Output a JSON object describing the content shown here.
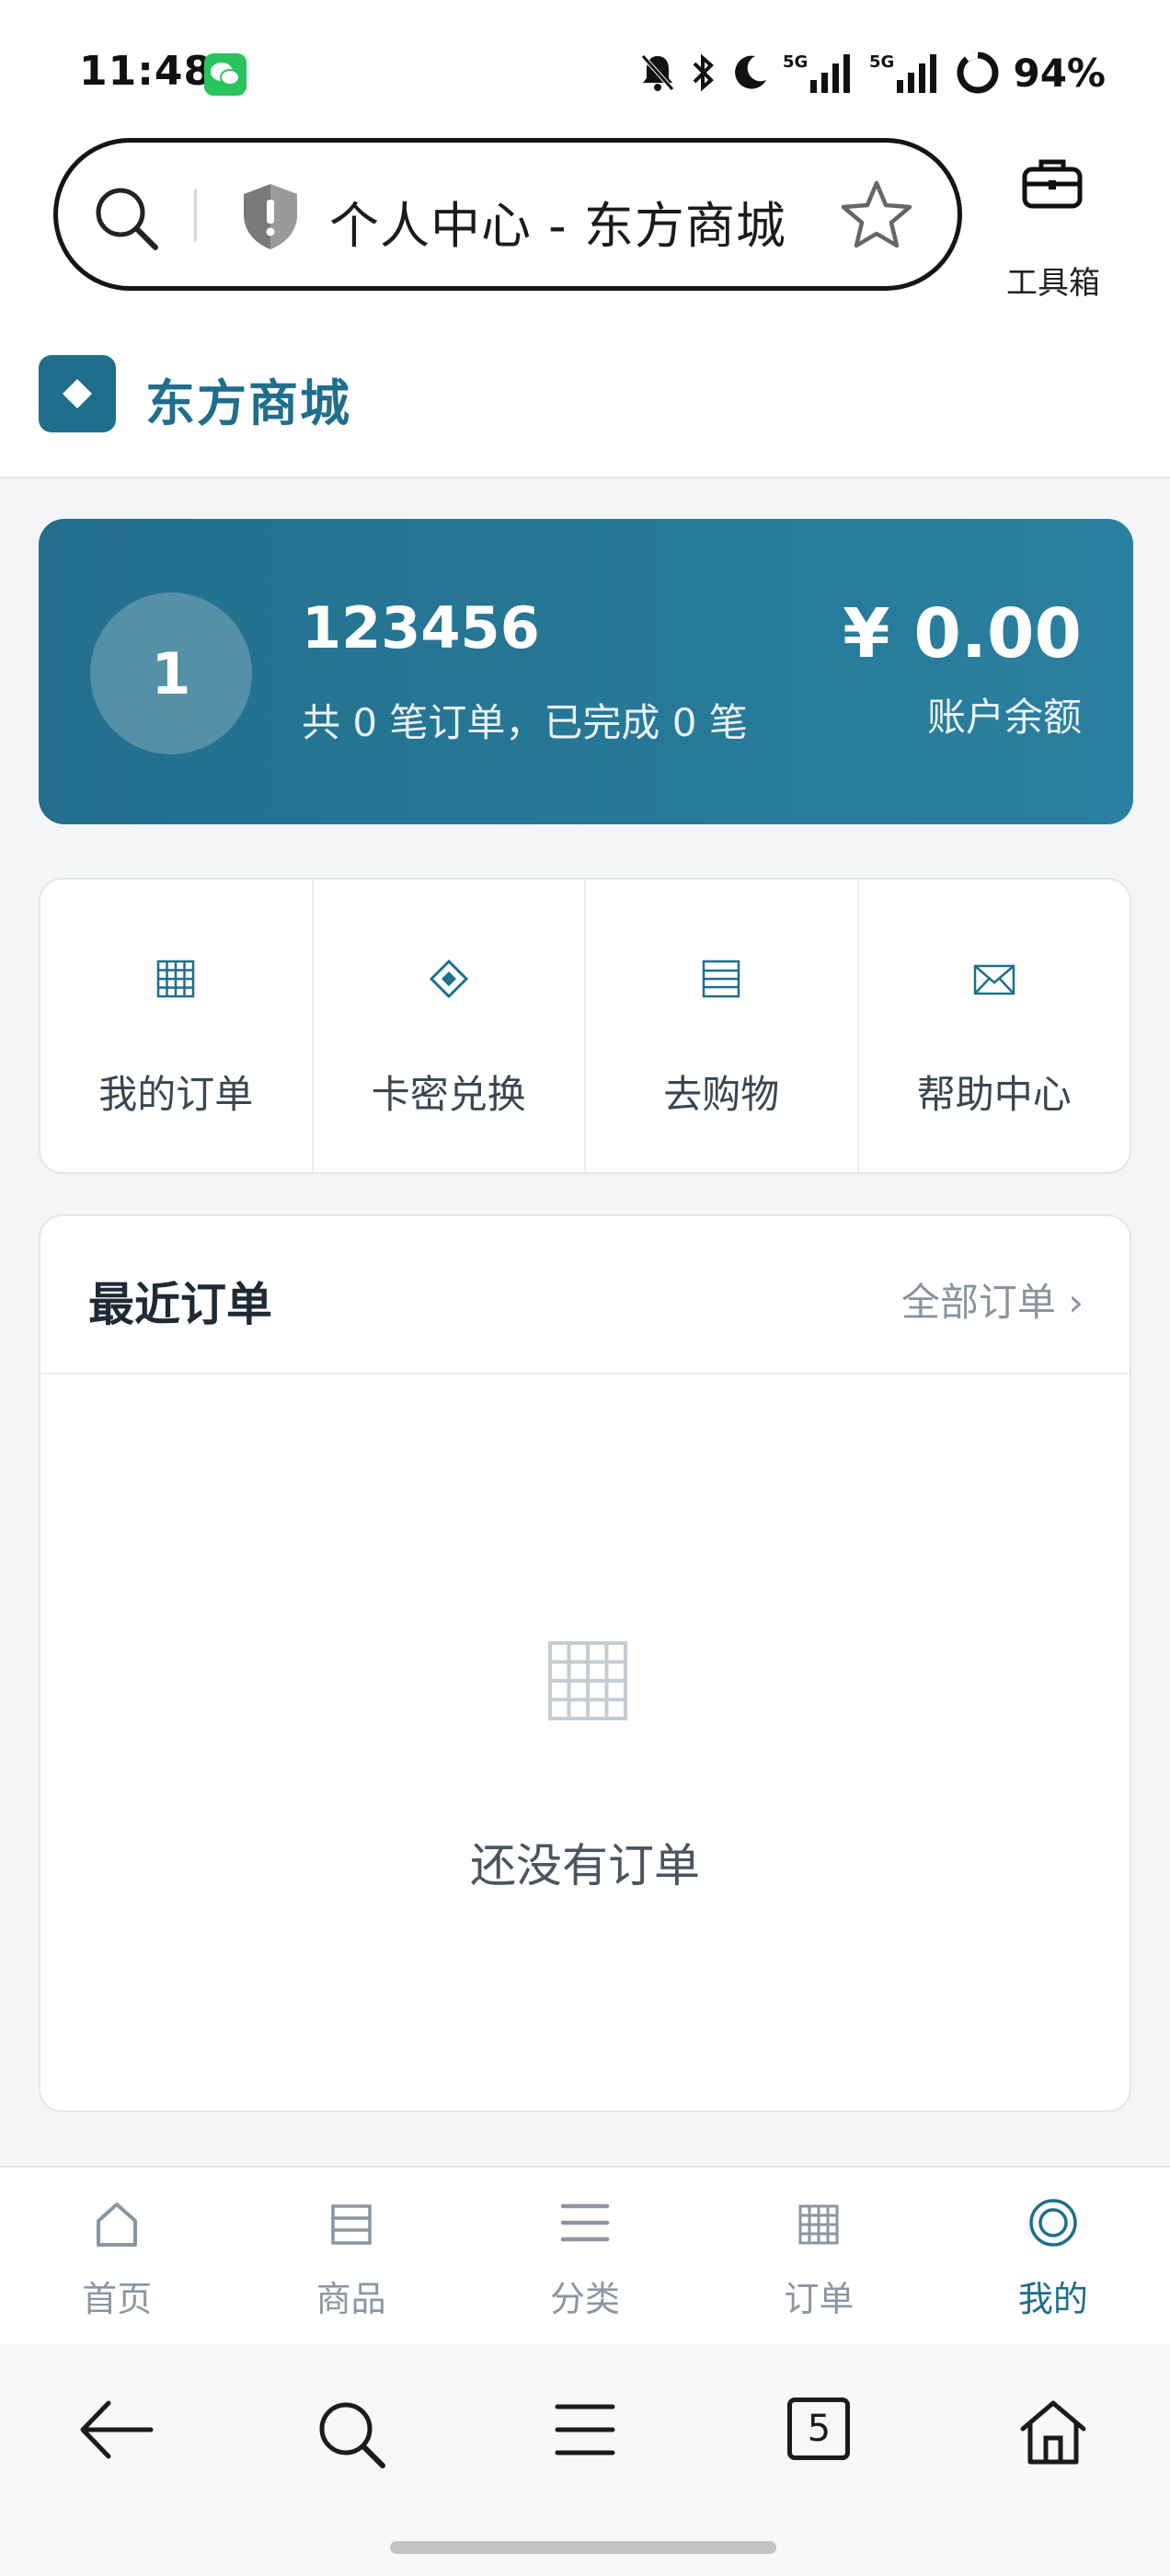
{
  "status_bar": {
    "time": "11:48",
    "battery": "94%",
    "net1": "5G",
    "net2": "5G"
  },
  "browser": {
    "page_title": "个人中心 - 东方商城",
    "toolbox_label": "工具箱"
  },
  "site": {
    "name": "东方商城"
  },
  "user": {
    "avatar_text": "1",
    "name": "123456",
    "order_summary": "共 0 笔订单，已完成 0 笔",
    "balance": "¥ 0.00",
    "balance_label": "账户余额"
  },
  "quick_actions": [
    {
      "label": "我的订单",
      "icon": "grid-icon"
    },
    {
      "label": "卡密兑换",
      "icon": "diamond-icon"
    },
    {
      "label": "去购物",
      "icon": "list-icon"
    },
    {
      "label": "帮助中心",
      "icon": "envelope-icon"
    }
  ],
  "recent_orders": {
    "title": "最近订单",
    "all_link": "全部订单 ›",
    "empty_text": "还没有订单"
  },
  "tabbar": [
    {
      "label": "首页",
      "icon": "home-icon"
    },
    {
      "label": "商品",
      "icon": "list-icon"
    },
    {
      "label": "分类",
      "icon": "menu-icon"
    },
    {
      "label": "订单",
      "icon": "grid-icon"
    },
    {
      "label": "我的",
      "icon": "profile-icon",
      "active": true
    }
  ],
  "browser_nav": {
    "tab_count": "5"
  },
  "colors": {
    "brand": "#1f6e8c",
    "card_start": "#236f8d",
    "card_end": "#2a80a0",
    "muted": "#8a96a2"
  }
}
